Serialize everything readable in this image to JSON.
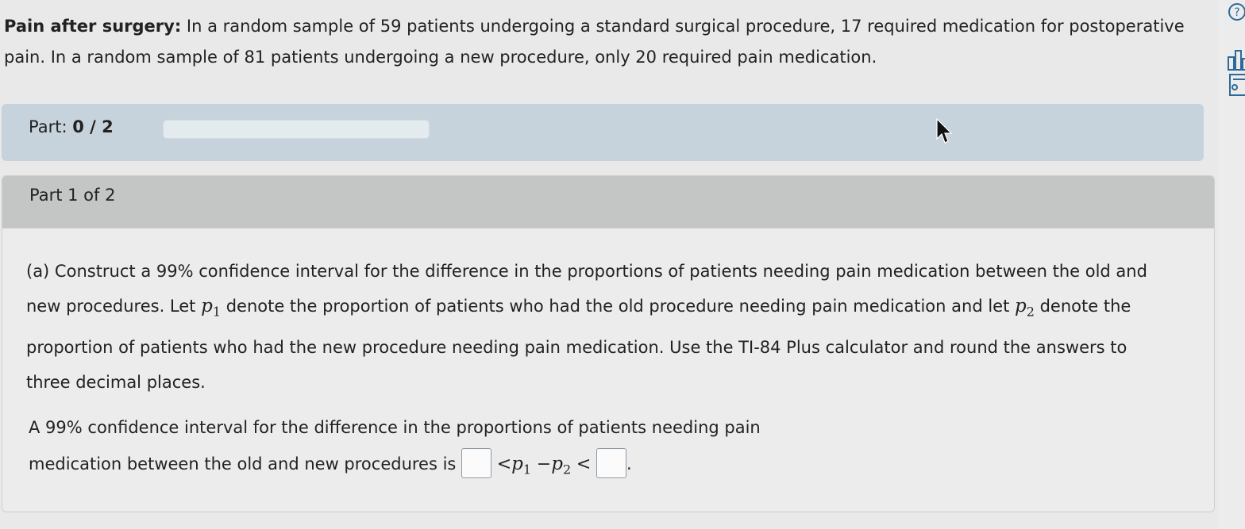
{
  "problem": {
    "title": "Pain after surgery:",
    "text": " In a random sample of 59 patients undergoing a standard surgical procedure, 17 required medication for postoperative pain. In a random sample of 81 patients undergoing a new procedure, only 20 required pain medication."
  },
  "part_bar": {
    "label": "Part:",
    "progress": "0 / 2",
    "progress_fraction": 0
  },
  "section": {
    "title": "Part 1 of 2",
    "question": {
      "s1": "(a) Construct a 99% confidence interval for the difference in the proportions of patients needing pain medication between the old and new procedures. Let ",
      "p1_var": "p",
      "p1_sub": "1",
      "s2": " denote the proportion of patients who had the old procedure needing pain medication and let ",
      "p2_var": "p",
      "p2_sub": "2",
      "s3": " denote the proportion of patients who had the new procedure needing pain medication. Use the TI-84 Plus calculator and round the answers to three decimal places."
    },
    "answer": {
      "line1": "A 99% confidence interval for the difference in the proportions of patients needing pain",
      "line2": "medication between the old and new procedures is ",
      "lt1": "<",
      "p1_var": "p",
      "p1_sub": "1",
      "minus": "−",
      "p2_var": "p",
      "p2_sub": "2",
      "lt2": "<",
      "period": "."
    }
  },
  "side_icons": [
    "help-icon",
    "bar-chart-icon",
    "notes-icon"
  ]
}
